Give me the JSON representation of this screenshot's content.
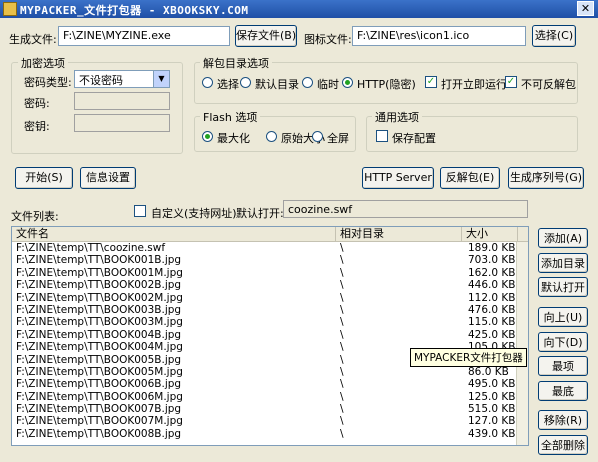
{
  "window": {
    "title": "MYPACKER_文件打包器 - XBOOKSKY.COM",
    "close_label": "✕"
  },
  "output": {
    "label": "生成文件:",
    "value": "F:\\ZINE\\MYZINE.exe",
    "save_button": "保存文件(B)"
  },
  "icon_file": {
    "label": "图标文件:",
    "value": "F:\\ZINE\\res\\icon1.ico",
    "select_button": "选择(C)"
  },
  "encryption": {
    "title": "加密选项",
    "type_label": "密码类型:",
    "type_value": "不设密码",
    "password_label": "密码:",
    "password_value": "",
    "key_label": "密钥:",
    "key_value": ""
  },
  "extract": {
    "title": "解包目录选项",
    "options": [
      "选择",
      "默认目录",
      "临时",
      "HTTP(隐密)"
    ],
    "selected": 3,
    "run_after_open": {
      "label": "打开立即运行",
      "checked": true
    },
    "no_unpack": {
      "label": "不可反解包",
      "checked": true
    }
  },
  "flash": {
    "title": "Flash 选项",
    "options": [
      "最大化",
      "原始大小",
      "全屏"
    ],
    "selected": 0
  },
  "general": {
    "title": "通用选项",
    "save_config": {
      "label": "保存配置",
      "checked": false
    }
  },
  "actions": {
    "start": "开始(S)",
    "info": "信息设置",
    "http_server": "HTTP Server",
    "unpack": "反解包(E)",
    "serial": "生成序列号(G)"
  },
  "filelist": {
    "label": "文件列表:",
    "custom_label": "自定义(支持网址)",
    "default_open_label": "默认打开:",
    "default_open_value": "coozine.swf",
    "columns": [
      "文件名",
      "相对目录",
      "大小"
    ],
    "rows": [
      [
        "F:\\ZINE\\temp\\TT\\coozine.swf",
        "\\",
        "189.0 KB"
      ],
      [
        "F:\\ZINE\\temp\\TT\\BOOK001B.jpg",
        "\\",
        "703.0 KB"
      ],
      [
        "F:\\ZINE\\temp\\TT\\BOOK001M.jpg",
        "\\",
        "162.0 KB"
      ],
      [
        "F:\\ZINE\\temp\\TT\\BOOK002B.jpg",
        "\\",
        "446.0 KB"
      ],
      [
        "F:\\ZINE\\temp\\TT\\BOOK002M.jpg",
        "\\",
        "112.0 KB"
      ],
      [
        "F:\\ZINE\\temp\\TT\\BOOK003B.jpg",
        "\\",
        "476.0 KB"
      ],
      [
        "F:\\ZINE\\temp\\TT\\BOOK003M.jpg",
        "\\",
        "115.0 KB"
      ],
      [
        "F:\\ZINE\\temp\\TT\\BOOK004B.jpg",
        "\\",
        "425.0 KB"
      ],
      [
        "F:\\ZINE\\temp\\TT\\BOOK004M.jpg",
        "\\",
        "105.0 KB"
      ],
      [
        "F:\\ZINE\\temp\\TT\\BOOK005B.jpg",
        "\\",
        ""
      ],
      [
        "F:\\ZINE\\temp\\TT\\BOOK005M.jpg",
        "\\",
        "86.0 KB"
      ],
      [
        "F:\\ZINE\\temp\\TT\\BOOK006B.jpg",
        "\\",
        "495.0 KB"
      ],
      [
        "F:\\ZINE\\temp\\TT\\BOOK006M.jpg",
        "\\",
        "125.0 KB"
      ],
      [
        "F:\\ZINE\\temp\\TT\\BOOK007B.jpg",
        "\\",
        "515.0 KB"
      ],
      [
        "F:\\ZINE\\temp\\TT\\BOOK007M.jpg",
        "\\",
        "127.0 KB"
      ],
      [
        "F:\\ZINE\\temp\\TT\\BOOK008B.jpg",
        "\\",
        "439.0 KB"
      ]
    ],
    "tooltip": "MYPACKER文件打包器"
  },
  "side_buttons": {
    "add": "添加(A)",
    "add_dir": "添加目录",
    "default_open": "默认打开",
    "up": "向上(U)",
    "down": "向下(D)",
    "top": "最项",
    "bottom": "最底",
    "remove": "移除(R)",
    "remove_all": "全部删除"
  }
}
